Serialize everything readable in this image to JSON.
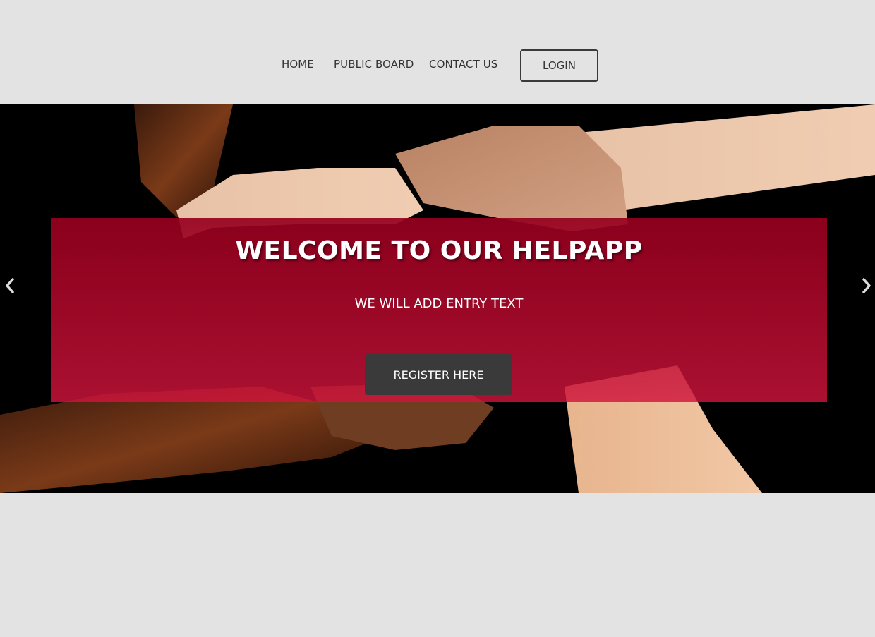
{
  "nav": {
    "home": "HOME",
    "public_board": "PUBLIC BOARD",
    "contact": "CONTACT US",
    "login": "LOGIN"
  },
  "hero": {
    "title": "WELCOME TO OUR HELPAPP",
    "subtitle": "WE WILL ADD ENTRY TEXT",
    "register": "REGISTER HERE",
    "image": "four hands gripping wrists in a square on black background",
    "prev_icon": "chevron-left-icon",
    "next_icon": "chevron-right-icon"
  },
  "colors": {
    "page_bg": "#e3e3e3",
    "overlay": "#c8143c",
    "button_dark": "#3a3a3a",
    "text_dark": "#333333"
  }
}
